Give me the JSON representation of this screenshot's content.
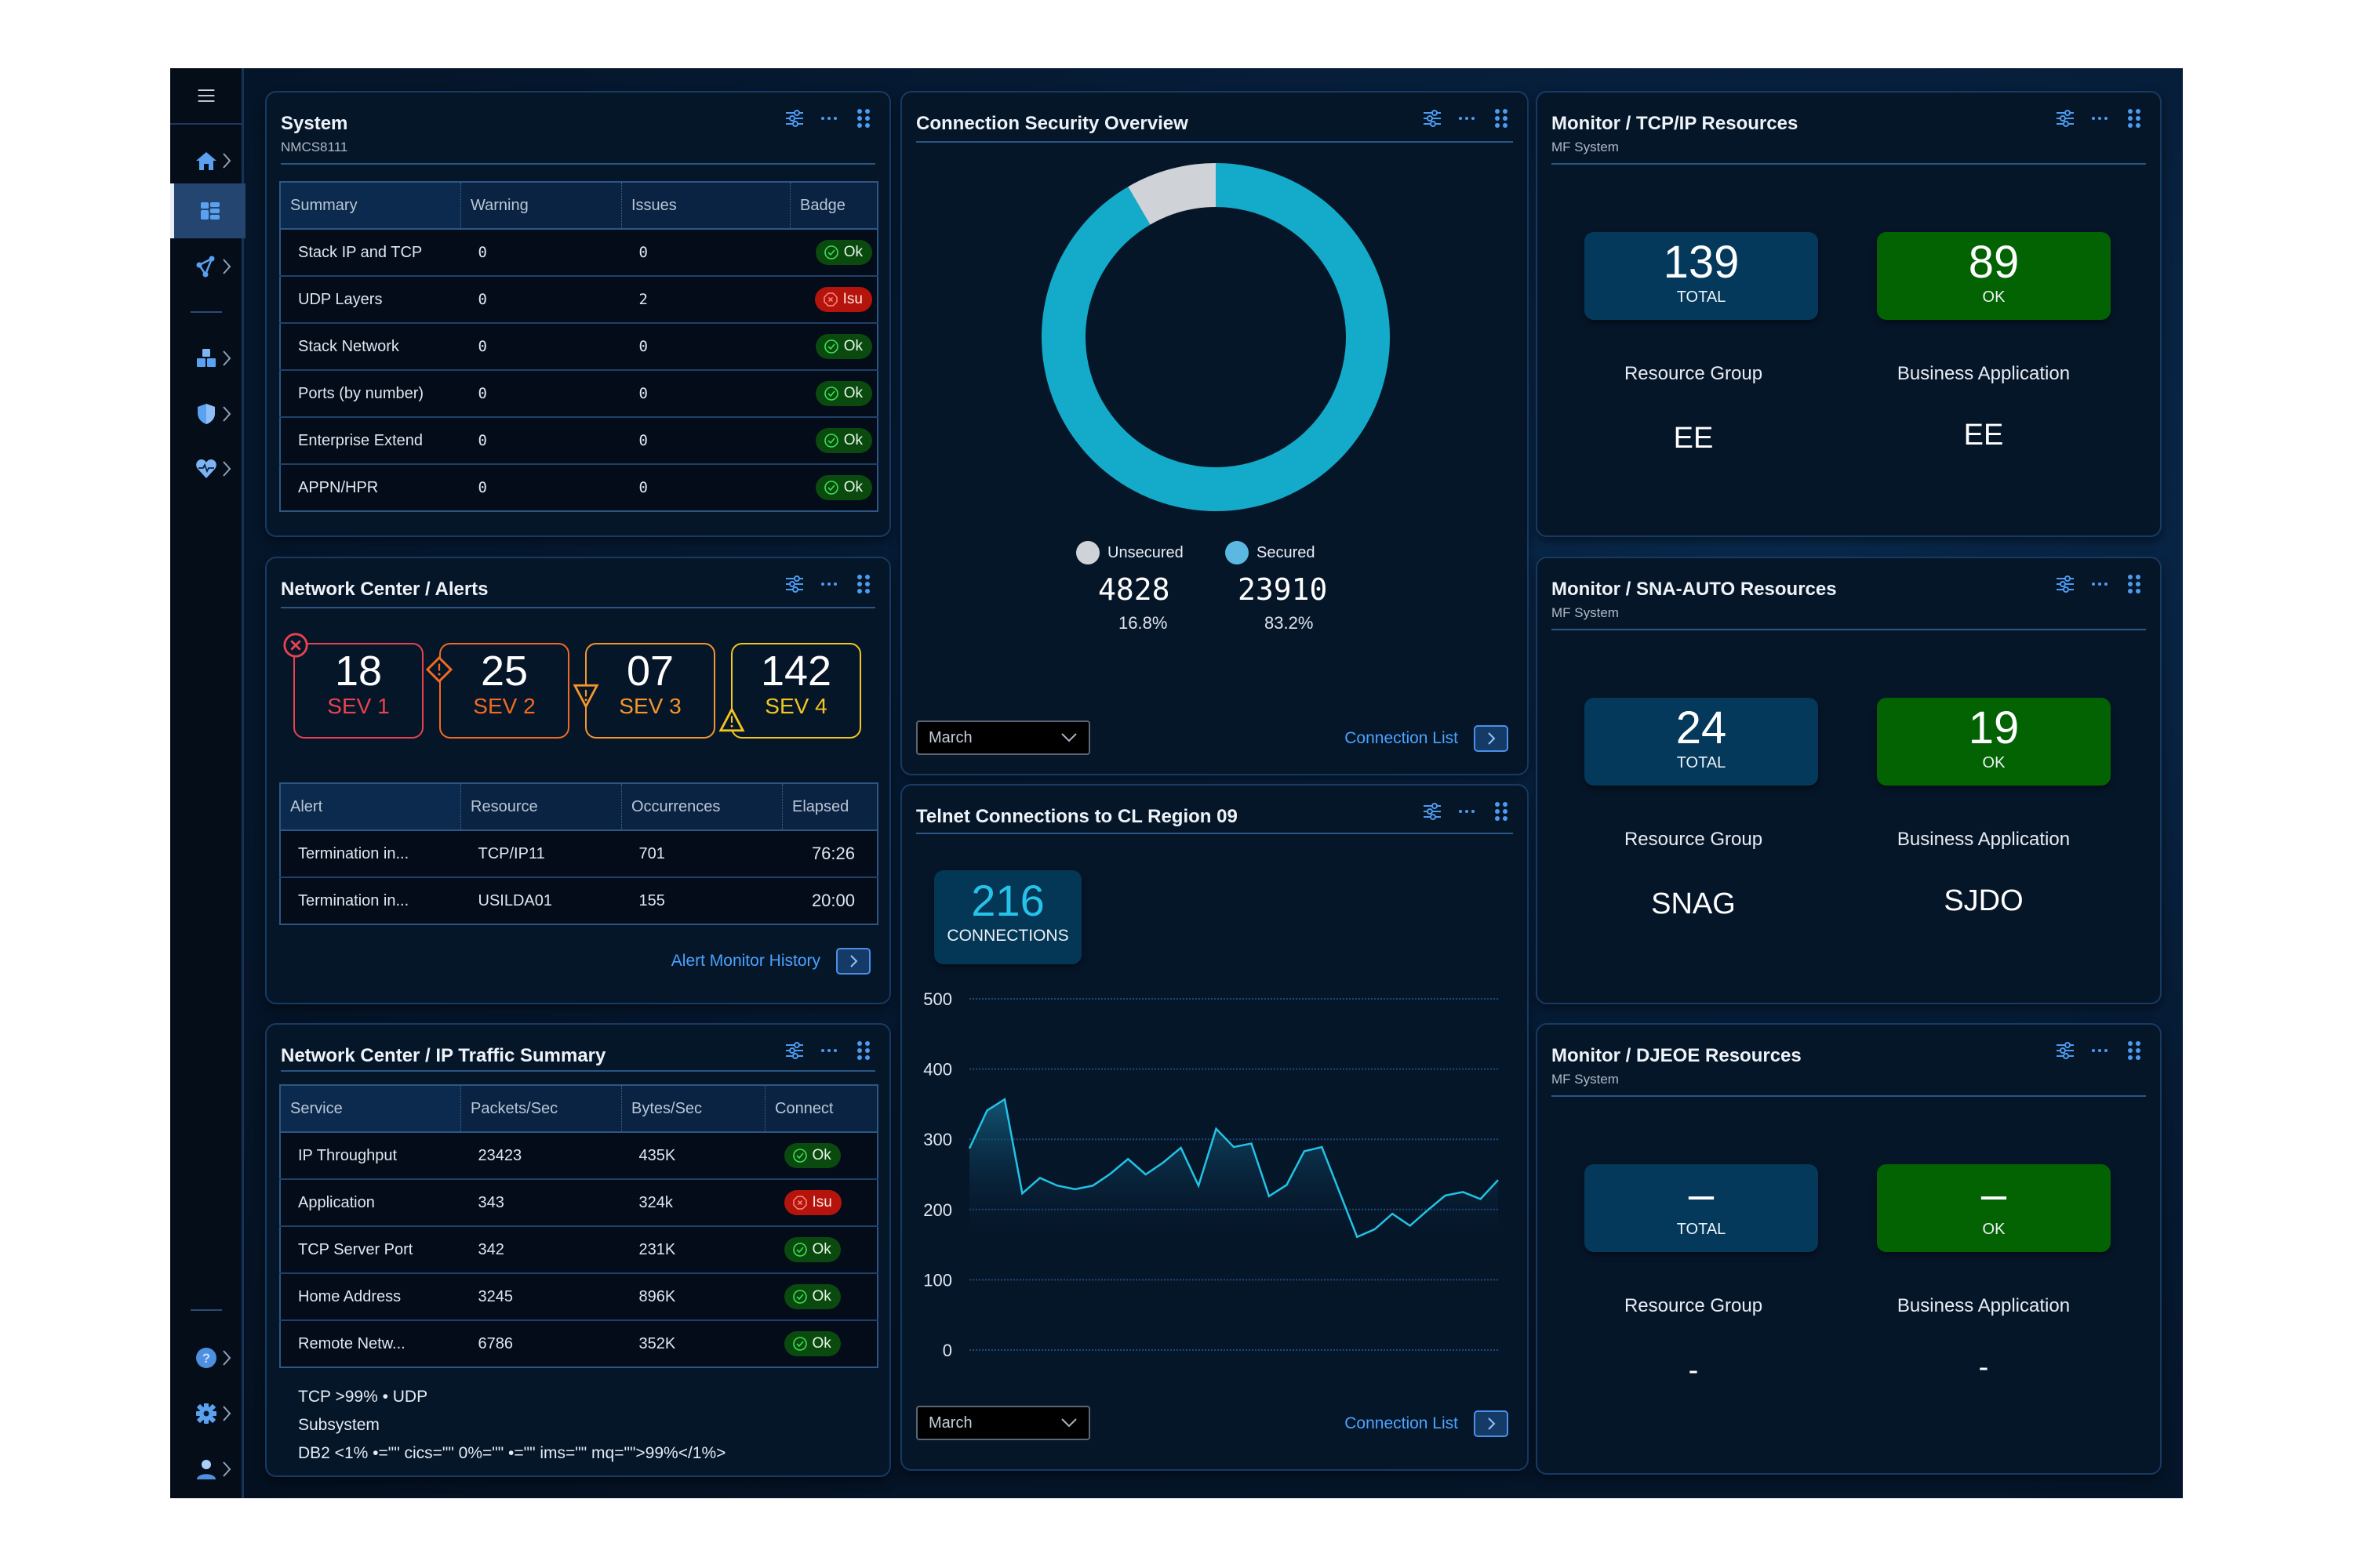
{
  "sidebar": {
    "items": [
      {
        "icon": "home-icon",
        "label": "Home"
      },
      {
        "icon": "dashboard-icon",
        "label": "Dashboard",
        "active": true
      },
      {
        "icon": "network-icon",
        "label": "Topology"
      },
      {
        "icon": "cubes-icon",
        "label": "Resources"
      },
      {
        "icon": "shield-icon",
        "label": "Security"
      },
      {
        "icon": "heart-pulse-icon",
        "label": "Health"
      },
      {
        "icon": "help-icon",
        "label": "Help"
      },
      {
        "icon": "gear-icon",
        "label": "Settings"
      },
      {
        "icon": "user-icon",
        "label": "User"
      }
    ]
  },
  "system": {
    "title": "System",
    "subtitle": "NMCS8111",
    "columns": [
      "Summary",
      "Warning",
      "Issues",
      "Badge"
    ],
    "rows": [
      {
        "summary": "Stack IP and TCP",
        "warning": "0",
        "issues": "0",
        "badge": "Ok",
        "status": "ok"
      },
      {
        "summary": "UDP Layers",
        "warning": "0",
        "issues": "2",
        "badge": "Isu",
        "status": "isu"
      },
      {
        "summary": "Stack Network",
        "warning": "0",
        "issues": "0",
        "badge": "Ok",
        "status": "ok"
      },
      {
        "summary": "Ports (by number)",
        "warning": "0",
        "issues": "0",
        "badge": "Ok",
        "status": "ok"
      },
      {
        "summary": "Enterprise Extend",
        "warning": "0",
        "issues": "0",
        "badge": "Ok",
        "status": "ok"
      },
      {
        "summary": "APPN/HPR",
        "warning": "0",
        "issues": "0",
        "badge": "Ok",
        "status": "ok"
      }
    ]
  },
  "alerts": {
    "title": "Network Center / Alerts",
    "severities": [
      {
        "count": "18",
        "label": "SEV 1",
        "color": "#e8424f",
        "icon": "error-circle-icon"
      },
      {
        "count": "25",
        "label": "SEV 2",
        "color": "#f26a21",
        "icon": "warning-diamond-icon"
      },
      {
        "count": "07",
        "label": "SEV 3",
        "color": "#f5952a",
        "icon": "warning-triangle-down-icon"
      },
      {
        "count": "142",
        "label": "SEV 4",
        "color": "#f2c61f",
        "icon": "warning-triangle-icon"
      }
    ],
    "columns": [
      "Alert",
      "Resource",
      "Occurrences",
      "Elapsed"
    ],
    "rows": [
      {
        "alert": "Termination in...",
        "resource": "TCP/IP11",
        "occurrences": "701",
        "elapsed": "76:26"
      },
      {
        "alert": "Termination in...",
        "resource": "USILDA01",
        "occurrences": "155",
        "elapsed": "20:00"
      }
    ],
    "link_label": "Alert Monitor History"
  },
  "traffic": {
    "title": "Network Center / IP Traffic Summary",
    "columns": [
      "Service",
      "Packets/Sec",
      "Bytes/Sec",
      "Connect"
    ],
    "rows": [
      {
        "service": "IP Throughput",
        "packets": "23423",
        "bytes": "435K",
        "badge": "Ok",
        "status": "ok"
      },
      {
        "service": "Application",
        "packets": "343",
        "bytes": "324k",
        "badge": "Isu",
        "status": "isu"
      },
      {
        "service": "TCP Server Port",
        "packets": "342",
        "bytes": "231K",
        "badge": "Ok",
        "status": "ok"
      },
      {
        "service": "Home Address",
        "packets": "3245",
        "bytes": "896K",
        "badge": "Ok",
        "status": "ok"
      },
      {
        "service": "Remote Netw...",
        "packets": "6786",
        "bytes": "352K",
        "badge": "Ok",
        "status": "ok"
      }
    ],
    "footnote": [
      "TCP >99% • UDP",
      "Subsystem",
      "DB2 <1% •=\"\" cics=\"\" 0%=\"\" •=\"\" ims=\"\" mq=\"\">99%</1%>"
    ]
  },
  "security": {
    "title": "Connection Security Overview",
    "legend": [
      {
        "label": "Unsecured",
        "value": "4828",
        "percent": "16.8%",
        "color": "#cfd3d8"
      },
      {
        "label": "Secured",
        "value": "23910",
        "percent": "83.2%",
        "color": "#5bb8e0"
      }
    ],
    "month_select": "March",
    "link_label": "Connection List"
  },
  "telnet": {
    "title": "Telnet Connections to CL Region 09",
    "kpi_value": "216",
    "kpi_label": "CONNECTIONS",
    "month_select": "March",
    "link_label": "Connection List"
  },
  "monitors": [
    {
      "title": "Monitor /  TCP/IP Resources",
      "subtitle": "MF System",
      "total": "139",
      "total_label": "TOTAL",
      "ok": "89",
      "ok_label": "OK",
      "rg_label": "Resource Group",
      "rg_value": "EE",
      "ba_label": "Business Application",
      "ba_value": "EE"
    },
    {
      "title": "Monitor / SNA-AUTO Resources",
      "subtitle": "MF System",
      "total": "24",
      "total_label": "TOTAL",
      "ok": "19",
      "ok_label": "OK",
      "rg_label": "Resource Group",
      "rg_value": "SNAG",
      "ba_label": "Business Application",
      "ba_value": "SJDO"
    },
    {
      "title": "Monitor /  DJEOE Resources",
      "subtitle": "MF System",
      "total": "–",
      "total_label": "TOTAL",
      "ok": "–",
      "ok_label": "OK",
      "rg_label": "Resource Group",
      "rg_value": "-",
      "ba_label": "Business Application",
      "ba_value": "-"
    }
  ],
  "colors": {
    "accent": "#4aa3ff",
    "ok_badge": "#0a4a0e",
    "issue_badge": "#b5140c",
    "kpi_blue": "#04395c",
    "kpi_green": "#036303",
    "series_line": "#22c3e6"
  },
  "chart_data": [
    {
      "type": "pie",
      "title": "Connection Security Overview",
      "categories": [
        "Unsecured",
        "Secured"
      ],
      "values": [
        4828,
        23910
      ],
      "percents": [
        16.8,
        83.2
      ],
      "colors": [
        "#cfd3d8",
        "#13abc9"
      ],
      "donut": true,
      "legend": "bottom"
    },
    {
      "type": "area",
      "title": "Telnet Connections to CL Region 09",
      "xlabel": "",
      "ylabel": "",
      "ylim": [
        0,
        500
      ],
      "yticks": [
        0,
        100,
        200,
        300,
        400,
        500
      ],
      "grid": true,
      "series": [
        {
          "name": "Connections",
          "values": [
            287,
            341,
            357,
            223,
            245,
            234,
            229,
            234,
            251,
            272,
            250,
            267,
            288,
            234,
            315,
            289,
            294,
            219,
            235,
            283,
            289,
            225,
            161,
            172,
            194,
            177,
            199,
            220,
            225,
            215,
            242
          ]
        }
      ]
    }
  ]
}
